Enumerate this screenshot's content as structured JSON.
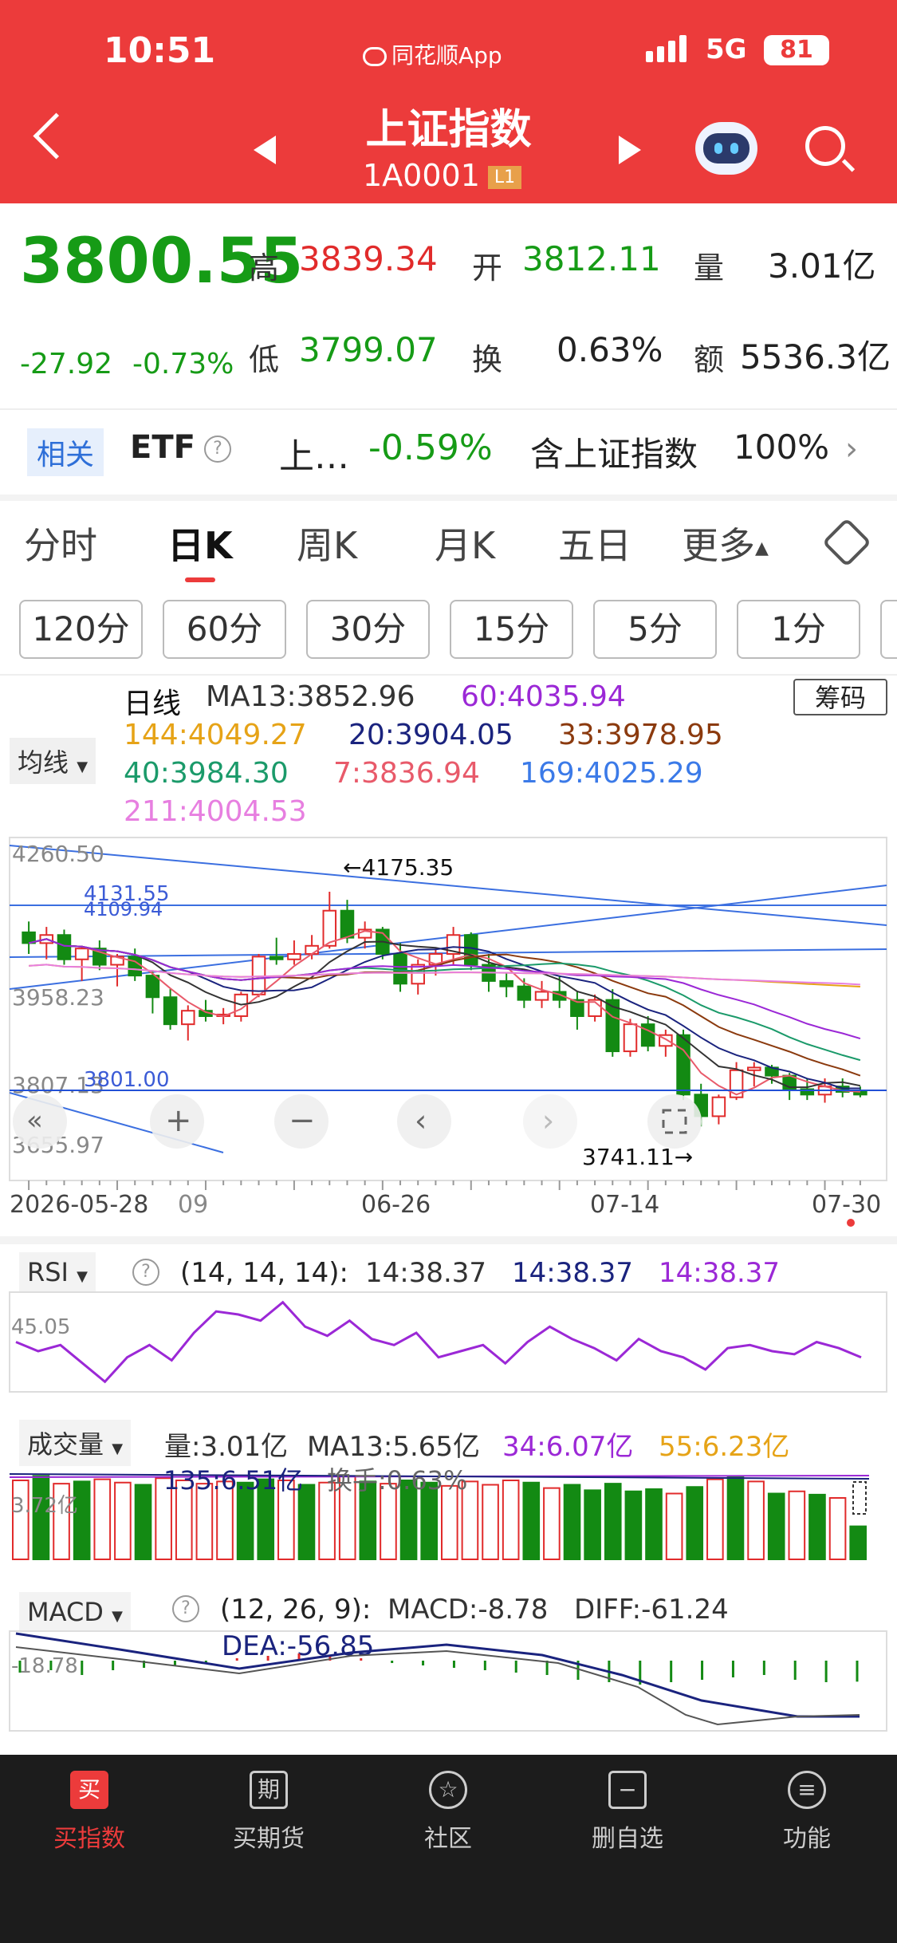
{
  "status_bar": {
    "time": "10:51",
    "app_name": "同花顺App",
    "network": "5G",
    "battery": "81"
  },
  "header": {
    "title": "上证指数",
    "code": "1A0001",
    "level_badge": "L1"
  },
  "quote": {
    "price": "3800.55",
    "change": "-27.92",
    "change_pct": "-0.73%",
    "high_label": "高",
    "high": "3839.34",
    "open_label": "开",
    "open": "3812.11",
    "volume_label": "量",
    "volume": "3.01亿",
    "low_label": "低",
    "low": "3799.07",
    "turnover_label": "换",
    "turnover": "0.63%",
    "amount_label": "额",
    "amount": "5536.3亿"
  },
  "etf": {
    "tag": "相关",
    "label": "ETF",
    "name": "上…",
    "change": "-0.59%",
    "desc": "含上证指数",
    "pct": "100%"
  },
  "tabs": [
    "分时",
    "日K",
    "周K",
    "月K",
    "五日",
    "更多"
  ],
  "period_tabs": [
    "120分",
    "60分",
    "30分",
    "15分",
    "5分",
    "1分"
  ],
  "kline": {
    "chip_button": "筹码",
    "ma_dropdown": "均线",
    "ma": {
      "prefix": "日线",
      "ma13": "MA13:3852.96",
      "ma60": "60:4035.94",
      "ma144": "144:4049.27",
      "ma20": "20:3904.05",
      "ma33": "33:3978.95",
      "ma40": "40:3984.30",
      "ma7": "7:3836.94",
      "ma169": "169:4025.29",
      "ma211": "211:4004.53"
    },
    "y_labels": [
      "4260.50",
      "4131.55",
      "4109.94",
      "3958.23",
      "3807.13",
      "3801.00",
      "3655.97"
    ],
    "high_marker": "←4175.35",
    "low_marker": "3741.11→",
    "x_labels": [
      "2026-05-28",
      "09",
      "06-26",
      "07-14",
      "07-30"
    ],
    "colors": {
      "up": "#e12b2b",
      "down": "#138a13"
    }
  },
  "rsi": {
    "name": "RSI",
    "params": "(14, 14, 14):",
    "v1": "14:38.37",
    "v2": "14:38.37",
    "v3": "14:38.37",
    "axis": "45.05"
  },
  "volume": {
    "name": "成交量",
    "vol": "量:3.01亿",
    "ma13": "MA13:5.65亿",
    "ma34": "34:6.07亿",
    "ma55": "55:6.23亿",
    "ma135": "135:6.51亿",
    "turnover": "换手:0.63%",
    "axis": "3.72亿"
  },
  "macd": {
    "name": "MACD",
    "params": "(12, 26, 9):",
    "macd": "MACD:-8.78",
    "diff": "DIFF:-61.24",
    "dea": "DEA:-56.85",
    "axis": "-18.78"
  },
  "bottom_nav": [
    {
      "label": "买指数",
      "icon": "买"
    },
    {
      "label": "买期货",
      "icon": "期"
    },
    {
      "label": "社区",
      "icon": "☆"
    },
    {
      "label": "删自选",
      "icon": "−"
    },
    {
      "label": "功能",
      "icon": "≡"
    }
  ],
  "chart_data": {
    "type": "candlestick",
    "title": "日线",
    "x_range": [
      "2026-05-28",
      "07-30"
    ],
    "ylim": [
      3655.97,
      4260.5
    ],
    "ohlc": [
      [
        4100,
        4120,
        4060,
        4080
      ],
      [
        4080,
        4110,
        4050,
        4095
      ],
      [
        4095,
        4105,
        4040,
        4050
      ],
      [
        4050,
        4075,
        4010,
        4070
      ],
      [
        4070,
        4085,
        4030,
        4040
      ],
      [
        4040,
        4060,
        4000,
        4055
      ],
      [
        4055,
        4070,
        4010,
        4020
      ],
      [
        4020,
        4030,
        3950,
        3980
      ],
      [
        3980,
        3995,
        3920,
        3930
      ],
      [
        3930,
        3965,
        3900,
        3955
      ],
      [
        3955,
        3975,
        3935,
        3945
      ],
      [
        3945,
        3960,
        3930,
        3948
      ],
      [
        3945,
        3990,
        3935,
        3985
      ],
      [
        3985,
        4060,
        3980,
        4055
      ],
      [
        4055,
        4090,
        4040,
        4050
      ],
      [
        4050,
        4085,
        4040,
        4060
      ],
      [
        4060,
        4095,
        4050,
        4075
      ],
      [
        4075,
        4175,
        4070,
        4140
      ],
      [
        4140,
        4160,
        4080,
        4090
      ],
      [
        4090,
        4120,
        4070,
        4105
      ],
      [
        4105,
        4110,
        4050,
        4060
      ],
      [
        4060,
        4080,
        3990,
        4005
      ],
      [
        4005,
        4050,
        3985,
        4040
      ],
      [
        4040,
        4070,
        4020,
        4060
      ],
      [
        4060,
        4110,
        4040,
        4095
      ],
      [
        4095,
        4100,
        4030,
        4040
      ],
      [
        4040,
        4060,
        3990,
        4010
      ],
      [
        4010,
        4025,
        3980,
        4000
      ],
      [
        4000,
        4015,
        3960,
        3975
      ],
      [
        3975,
        4010,
        3960,
        3990
      ],
      [
        3990,
        4020,
        3960,
        3975
      ],
      [
        3975,
        3990,
        3920,
        3945
      ],
      [
        3945,
        3985,
        3935,
        3975
      ],
      [
        3975,
        3995,
        3870,
        3880
      ],
      [
        3880,
        3940,
        3870,
        3930
      ],
      [
        3930,
        3945,
        3880,
        3890
      ],
      [
        3890,
        3920,
        3870,
        3910
      ],
      [
        3910,
        3920,
        3790,
        3800
      ],
      [
        3800,
        3820,
        3741.11,
        3760
      ],
      [
        3760,
        3800,
        3745,
        3795
      ],
      [
        3795,
        3860,
        3790,
        3845
      ],
      [
        3845,
        3860,
        3815,
        3850
      ],
      [
        3850,
        3855,
        3820,
        3835
      ],
      [
        3835,
        3840,
        3790,
        3810
      ],
      [
        3810,
        3830,
        3790,
        3800
      ],
      [
        3800,
        3830,
        3785,
        3815
      ],
      [
        3815,
        3830,
        3795,
        3805
      ],
      [
        3805,
        3815,
        3795,
        3800
      ]
    ],
    "rsi_values": [
      45,
      42,
      44,
      38,
      32,
      40,
      44,
      39,
      48,
      55,
      54,
      52,
      58,
      50,
      47,
      52,
      46,
      44,
      48,
      40,
      42,
      44,
      38,
      45,
      50,
      46,
      43,
      39,
      46,
      42,
      40,
      36,
      43,
      44,
      42,
      41,
      45,
      43,
      40
    ],
    "volume_values": [
      7.2,
      7.6,
      6.9,
      7.1,
      7.3,
      7.0,
      6.8,
      7.4,
      7.2,
      6.9,
      7.1,
      7.0,
      7.3,
      7.2,
      6.8,
      7.0,
      7.6,
      7.1,
      6.9,
      7.2,
      7.0,
      6.7,
      7.1,
      6.8,
      7.2,
      7.0,
      6.5,
      6.8,
      6.3,
      6.9,
      6.2,
      6.4,
      6.0,
      6.6,
      7.3,
      7.5,
      7.1,
      6.0,
      6.2,
      5.9,
      5.6,
      3.01
    ],
    "macd_values": [
      -5,
      -4,
      -6,
      -4,
      -3,
      -2,
      -1,
      1,
      2,
      3,
      2,
      1,
      -1,
      -2,
      -3,
      -4,
      -5,
      -6,
      -8,
      -9,
      -10,
      -9,
      -8,
      -7,
      -6,
      -8,
      -9,
      -8.78
    ]
  }
}
